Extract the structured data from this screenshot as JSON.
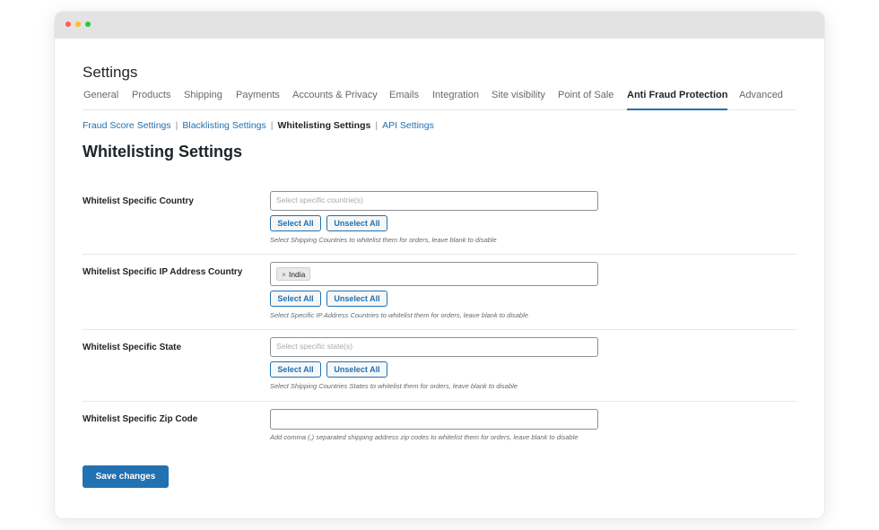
{
  "page": {
    "title": "Settings"
  },
  "tabs": [
    {
      "label": "General"
    },
    {
      "label": "Products"
    },
    {
      "label": "Shipping"
    },
    {
      "label": "Payments"
    },
    {
      "label": "Accounts & Privacy"
    },
    {
      "label": "Emails"
    },
    {
      "label": "Integration"
    },
    {
      "label": "Site visibility"
    },
    {
      "label": "Point of Sale"
    },
    {
      "label": "Anti Fraud Protection",
      "active": true
    },
    {
      "label": "Advanced"
    }
  ],
  "subnav": {
    "items": [
      {
        "label": "Fraud Score Settings"
      },
      {
        "label": "Blacklisting Settings"
      },
      {
        "label": "Whitelisting Settings",
        "current": true
      },
      {
        "label": "API Settings"
      }
    ],
    "separator": "|"
  },
  "section": {
    "title": "Whitelisting Settings"
  },
  "fields": [
    {
      "label": "Whitelist Specific Country",
      "placeholder": "Select specific countrie(s)",
      "select_all": "Select All",
      "unselect_all": "Unselect All",
      "description": "Select Shipping Countries to whitelist them for orders, leave blank to disable"
    },
    {
      "label": "Whitelist Specific IP Address Country",
      "selected": [
        {
          "remove": "×",
          "label": "India"
        }
      ],
      "select_all": "Select All",
      "unselect_all": "Unselect All",
      "description": "Select Specific IP Address Countries to whitelist them for orders, leave blank to disable"
    },
    {
      "label": "Whitelist Specific State",
      "placeholder": "Select specific state(s)",
      "select_all": "Select All",
      "unselect_all": "Unselect All",
      "description": "Select Shipping Countries States to whitelist them for orders, leave blank to disable"
    },
    {
      "label": "Whitelist Specific Zip Code",
      "value": "",
      "description": "Add comma (,) separated shipping address zip codes to whitelist them for orders, leave blank to disable"
    }
  ],
  "save_button": "Save changes",
  "colors": {
    "accent": "#2271b1",
    "text": "#1d2327",
    "muted": "#646970"
  }
}
